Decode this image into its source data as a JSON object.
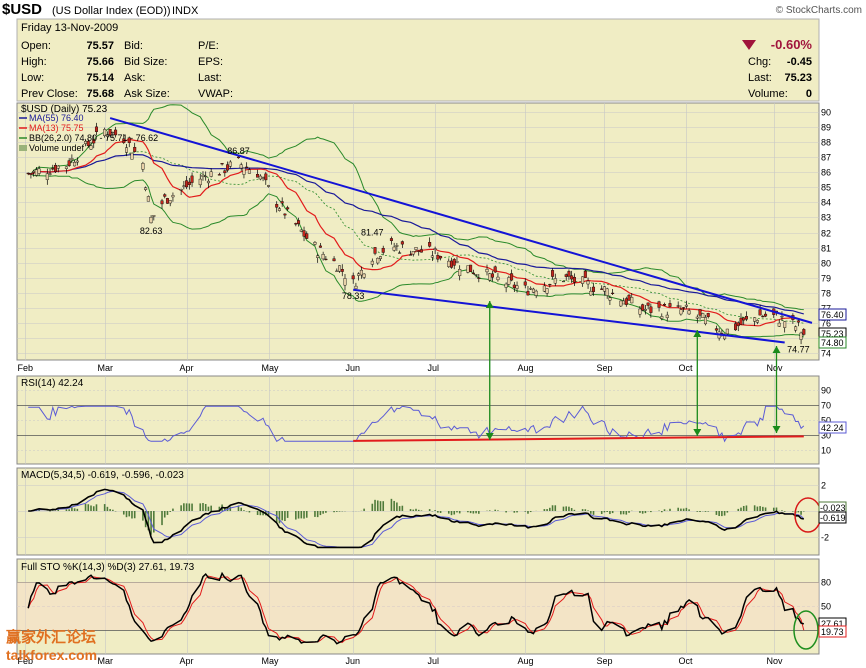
{
  "header": {
    "symbol": "$USD",
    "name": "(US Dollar Index (EOD))",
    "exchange": "INDX",
    "brand": "© StockCharts.com",
    "date": "Friday  13-Nov-2009",
    "labels": {
      "open": "Open:",
      "high": "High:",
      "low": "Low:",
      "prev_close": "Prev Close:",
      "bid": "Bid:",
      "bid_size": "Bid Size:",
      "ask": "Ask:",
      "ask_size": "Ask Size:",
      "pe": "P/E:",
      "eps": "EPS:",
      "last": "Last:",
      "vwap": "VWAP:",
      "chg": "Chg:",
      "last2": "Last:",
      "volume": "Volume:"
    },
    "open": "75.57",
    "high": "75.66",
    "low": "75.14",
    "prev_close": "75.68",
    "pct_change": "-0.60%",
    "chg": "-0.45",
    "last": "75.23",
    "volume": "0",
    "down_color": "#a0143c"
  },
  "legend": {
    "price": "$USD (Daily) 75.23",
    "ma55": "MA(55) 76.40",
    "ma13": "MA(13) 75.75",
    "bb": "BB(26,2.0) 74.80 - 75.71 - 76.62",
    "volume": "Volume undef",
    "rsi": "RSI(14) 42.24",
    "macd": "MACD(5,34,5) -0.619, -0.596, -0.023",
    "sto": "Full STO %K(14,3) %D(3) 27.61, 19.73"
  },
  "price_pane": {
    "yticks": [
      74,
      75,
      76,
      77,
      78,
      79,
      80,
      81,
      82,
      83,
      84,
      85,
      86,
      87,
      88,
      89,
      90
    ],
    "annotations": [
      "86.87",
      "82.63",
      "81.47",
      "78.33",
      "74.77"
    ],
    "value_tags": [
      "76.40",
      "75.23",
      "74.80"
    ]
  },
  "rsi_pane": {
    "yticks": [
      "90",
      "70",
      "50",
      "30",
      "10"
    ],
    "value_tag": "42.24"
  },
  "macd_pane": {
    "yticks": [
      "2",
      "0",
      "-2"
    ],
    "value_tags": [
      "-0.023",
      "-0.619"
    ]
  },
  "sto_pane": {
    "yticks": [
      "80",
      "50",
      "20"
    ],
    "value_tags": [
      "27.61",
      "19.73"
    ]
  },
  "months": [
    "Feb",
    "Mar",
    "Apr",
    "May",
    "Jun",
    "Jul",
    "Aug",
    "Sep",
    "Oct",
    "Nov"
  ],
  "watermark": {
    "cn": "赢家外汇论坛",
    "site": "talkforex.com"
  },
  "colors": {
    "pane_bg": "#f0edc4",
    "grid": "#c7c7c7",
    "price_up": "#e8d0a8",
    "price_down": "#c0261c",
    "ma55": "#1a1a99",
    "ma13": "#e21c1c",
    "bb": "#2a8a2a",
    "trendline": "#1414d6",
    "rsi": "#5b5bd6",
    "macd": "#000000",
    "signal": "#5b5bd6",
    "hist": "#4f7a3a",
    "sto_k": "#000000",
    "sto_d": "#e21c1c",
    "support": "#e21c1c",
    "arrows": "#1a8a1a",
    "circle_red": "#d81818",
    "circle_green": "#1f8f1f"
  },
  "chart_data": {
    "type": "candlestick",
    "title": "$USD (US Dollar Index (EOD)) INDX",
    "x": [
      "2009-02-02",
      "2009-02-16",
      "2009-03-02",
      "2009-03-09",
      "2009-03-16",
      "2009-03-19",
      "2009-03-24",
      "2009-04-06",
      "2009-04-20",
      "2009-04-27",
      "2009-05-04",
      "2009-05-11",
      "2009-05-18",
      "2009-05-26",
      "2009-06-01",
      "2009-06-08",
      "2009-06-15",
      "2009-07-01",
      "2009-07-15",
      "2009-08-03",
      "2009-08-17",
      "2009-09-01",
      "2009-09-15",
      "2009-10-01",
      "2009-10-15",
      "2009-10-28",
      "2009-11-03",
      "2009-11-11",
      "2009-11-13"
    ],
    "close": [
      85.9,
      86.5,
      88.8,
      88.3,
      86.6,
      82.9,
      84.2,
      85.6,
      86.6,
      86.0,
      84.0,
      82.5,
      81.0,
      79.9,
      78.6,
      80.5,
      81.1,
      80.6,
      79.5,
      78.2,
      79.0,
      78.2,
      76.9,
      76.8,
      75.4,
      76.5,
      76.4,
      75.7,
      75.23
    ],
    "annotations": [
      {
        "label": "86.87",
        "date": "2009-04-20",
        "value": 86.87
      },
      {
        "label": "82.63",
        "date": "2009-03-19",
        "value": 82.63
      },
      {
        "label": "81.47",
        "date": "2009-06-08",
        "value": 81.47
      },
      {
        "label": "78.33",
        "date": "2009-06-01",
        "value": 78.33
      },
      {
        "label": "74.77",
        "date": "2009-11-11",
        "value": 74.77
      }
    ],
    "ma55_last": 76.4,
    "ma13_last": 75.75,
    "bb_last": [
      74.8,
      75.71,
      76.62
    ],
    "rsi_last": 42.24,
    "macd_last": [
      -0.619,
      -0.596,
      -0.023
    ],
    "sto_last": [
      27.61,
      19.73
    ],
    "ylim": [
      74,
      90
    ],
    "grid": true,
    "legend": "top-left"
  }
}
